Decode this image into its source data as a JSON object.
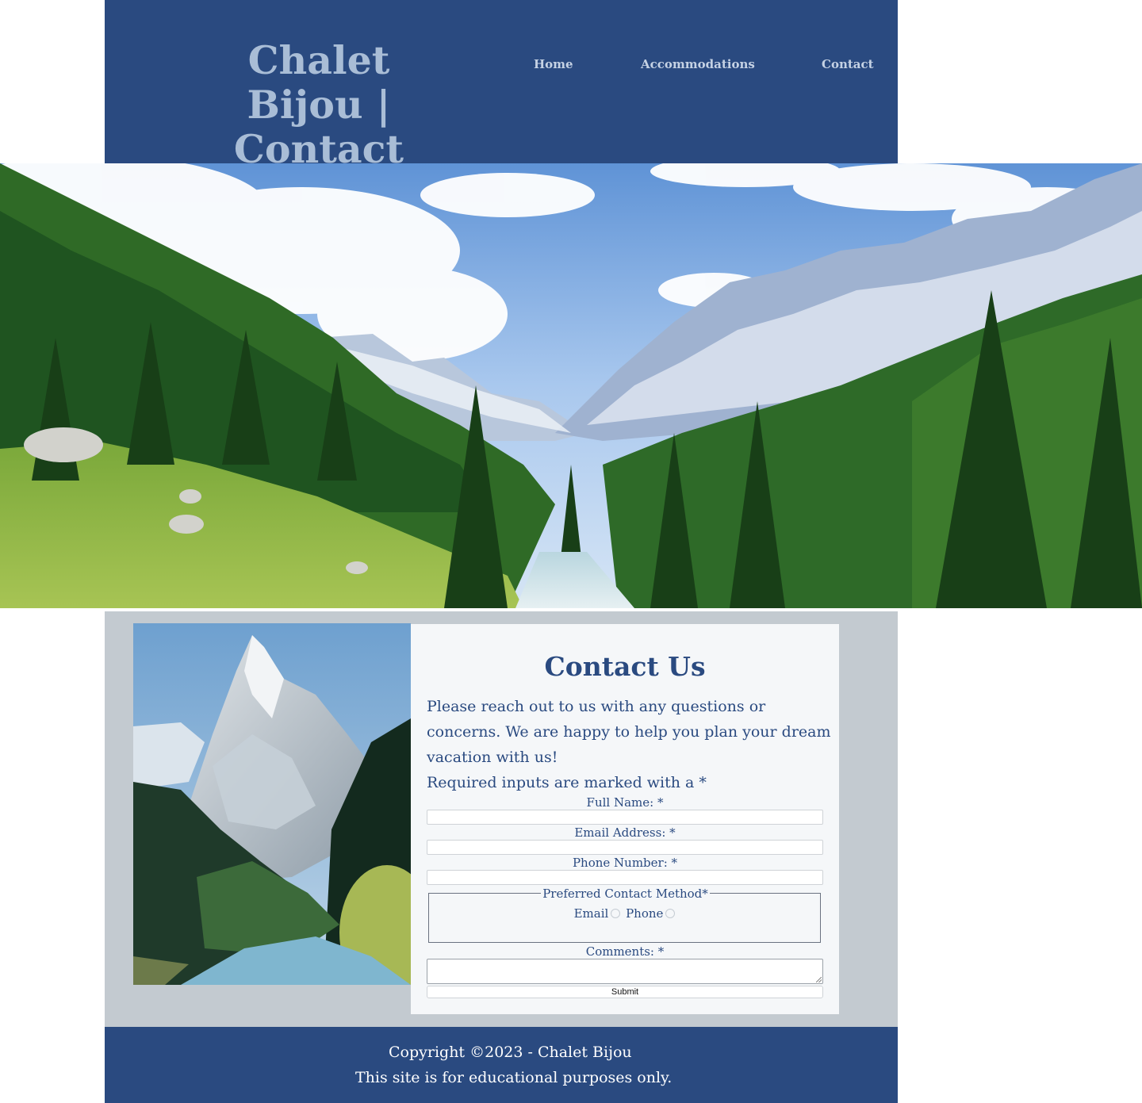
{
  "header": {
    "title_line1": "Chalet Bijou |",
    "title_line2": "Contact",
    "nav": [
      "Home",
      "Accommodations",
      "Contact"
    ]
  },
  "contact": {
    "title": "Contact Us",
    "intro": "Please reach out to us with any questions or concerns. We are happy to help you plan your dream vacation with us!",
    "required_note": "Required inputs are marked with a *",
    "full_name_label": "Full Name: *",
    "email_label": "Email Address: *",
    "phone_label": "Phone Number: *",
    "method_legend": "Preferred Contact Method*",
    "method_options": [
      "Email",
      "Phone"
    ],
    "comments_label": "Comments: *",
    "submit_label": "Submit"
  },
  "footer": {
    "line1": "Copyright ©2023 - Chalet Bijou",
    "line2": "This site is for educational purposes only."
  },
  "colors": {
    "brand_blue": "#2a4a80",
    "title_light": "#a9bdd6",
    "main_bg": "#c3cad0",
    "panel_bg": "#f5f7f9"
  }
}
